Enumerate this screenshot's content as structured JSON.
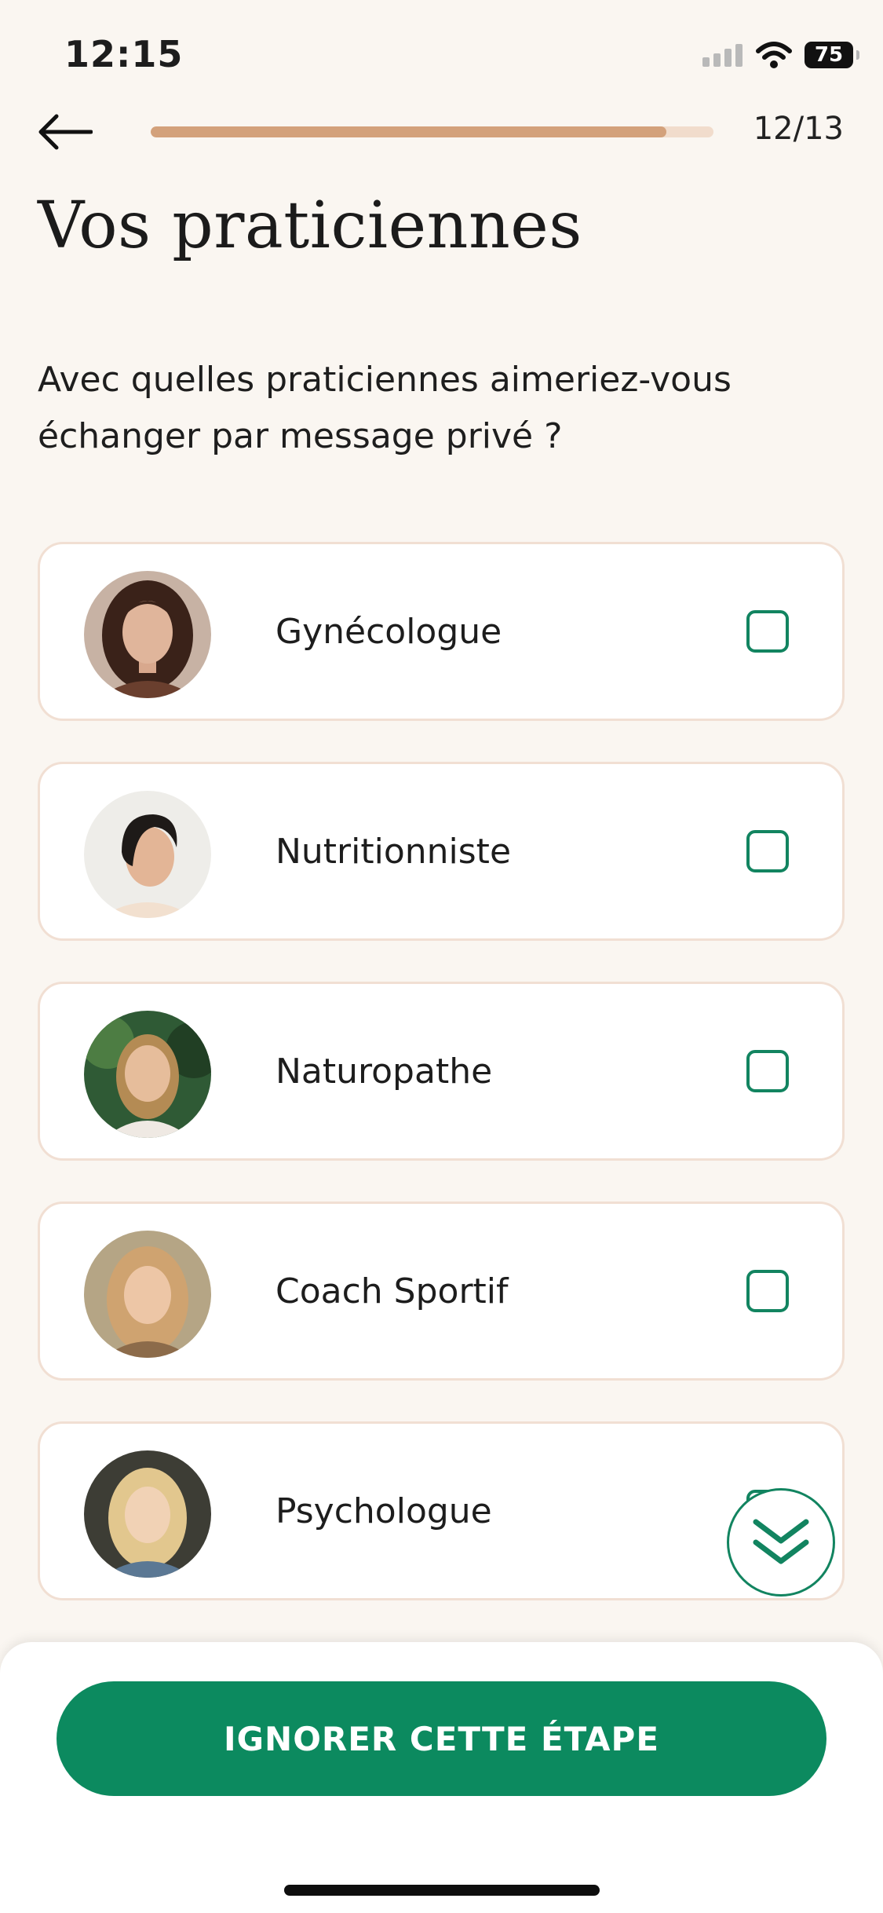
{
  "status_bar": {
    "time": "12:15",
    "battery": "75"
  },
  "header": {
    "progress_fraction": 0.917,
    "step_counter": "12/13"
  },
  "title": "Vos praticiennes",
  "question": "Avec quelles praticiennes aimeriez-vous échanger par message privé ?",
  "practitioners": [
    {
      "label": "Gynécologue",
      "checked": false
    },
    {
      "label": "Nutritionniste",
      "checked": false
    },
    {
      "label": "Naturopathe",
      "checked": false
    },
    {
      "label": "Coach Sportif",
      "checked": false
    },
    {
      "label": "Psychologue",
      "checked": false
    }
  ],
  "footer": {
    "skip_label": "IGNORER CETTE ÉTAPE"
  },
  "colors": {
    "accent": "#0c8a5f",
    "progress": "#d3a17b",
    "background": "#faf6f1"
  },
  "icons": {
    "back": "arrow-left-icon",
    "scroll": "double-chevron-down-icon"
  }
}
